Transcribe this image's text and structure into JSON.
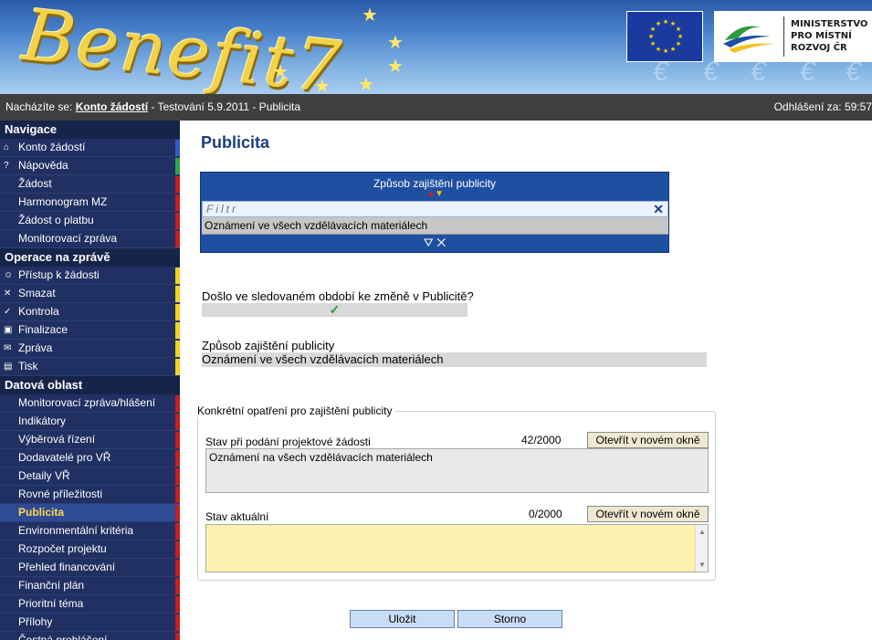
{
  "header": {
    "brand": "Benefit7",
    "ministry_lines": [
      "MINISTERSTVO",
      "PRO MÍSTNÍ",
      "ROZVOJ ČR"
    ]
  },
  "location_bar": {
    "prefix": "Nacházíte se:",
    "link": "Konto žádostí",
    "rest": "- Testování 5.9.2011 - Publicita",
    "logout": "Odhlášení za: 59:57"
  },
  "sidebar": {
    "sections": [
      {
        "title": "Navigace",
        "items": [
          {
            "label": "Konto žádostí",
            "icon": "home-icon",
            "glyph": "⌂",
            "marker": "blue"
          },
          {
            "label": "Nápověda",
            "icon": "help-icon",
            "glyph": "?",
            "marker": "green"
          },
          {
            "label": "Žádost",
            "icon": "",
            "glyph": "",
            "marker": "red"
          },
          {
            "label": "Harmonogram MZ",
            "icon": "",
            "glyph": "",
            "marker": "red"
          },
          {
            "label": "Žádost o platbu",
            "icon": "",
            "glyph": "",
            "marker": "red"
          },
          {
            "label": "Monitorovací zpráva",
            "icon": "",
            "glyph": "",
            "marker": "red"
          }
        ]
      },
      {
        "title": "Operace na zprávě",
        "items": [
          {
            "label": "Přístup k žádosti",
            "icon": "user-icon",
            "glyph": "☺",
            "marker": "yellow"
          },
          {
            "label": "Smazat",
            "icon": "delete-icon",
            "glyph": "✕",
            "marker": "yellow"
          },
          {
            "label": "Kontrola",
            "icon": "check-icon",
            "glyph": "✓",
            "marker": "yellow"
          },
          {
            "label": "Finalizace",
            "icon": "lock-icon",
            "glyph": "▣",
            "marker": "yellow"
          },
          {
            "label": "Zpráva",
            "icon": "mail-icon",
            "glyph": "✉",
            "marker": "yellow"
          },
          {
            "label": "Tisk",
            "icon": "print-icon",
            "glyph": "▤",
            "marker": "yellow"
          }
        ]
      },
      {
        "title": "Datová oblast",
        "items": [
          {
            "label": "Monitorovací zpráva/hlášení",
            "icon": "",
            "glyph": "",
            "marker": "red"
          },
          {
            "label": "Indikátory",
            "icon": "",
            "glyph": "",
            "marker": "red"
          },
          {
            "label": "Výběrová řízení",
            "icon": "",
            "glyph": "",
            "marker": "red"
          },
          {
            "label": "Dodavatelé pro VŘ",
            "icon": "",
            "glyph": "",
            "marker": "red"
          },
          {
            "label": "Detaily VŘ",
            "icon": "",
            "glyph": "",
            "marker": "red"
          },
          {
            "label": "Rovné příležitosti",
            "icon": "",
            "glyph": "",
            "marker": "red"
          },
          {
            "label": "Publicita",
            "icon": "",
            "glyph": "",
            "marker": "red",
            "active": true
          },
          {
            "label": "Environmentální kritéria",
            "icon": "",
            "glyph": "",
            "marker": "red"
          },
          {
            "label": "Rozpočet projektu",
            "icon": "",
            "glyph": "",
            "marker": "red"
          },
          {
            "label": "Přehled financování",
            "icon": "",
            "glyph": "",
            "marker": "red"
          },
          {
            "label": "Finanční plán",
            "icon": "",
            "glyph": "",
            "marker": "red"
          },
          {
            "label": "Prioritní téma",
            "icon": "",
            "glyph": "",
            "marker": "red"
          },
          {
            "label": "Přílohy",
            "icon": "",
            "glyph": "",
            "marker": "red"
          },
          {
            "label": "Čestná prohlášení",
            "icon": "",
            "glyph": "",
            "marker": "red"
          }
        ]
      }
    ]
  },
  "main": {
    "title": "Publicita",
    "grid": {
      "column_header": "Způsob zajištění publicity",
      "filter_placeholder": "Filtr",
      "rows": [
        "Oznámení ve všech vzdělávacích materiálech"
      ]
    },
    "question1": {
      "label": "Došlo ve sledovaném období ke změně v Publicitě?",
      "value": "✓"
    },
    "question2": {
      "label": "Způsob zajištění publicity",
      "value": "Oznámení ve všech vzdělávacích materiálech"
    },
    "fieldset": {
      "legend": "Konkrétní opatření pro zajištění publicity",
      "field1": {
        "label": "Stav při podání projektové žádosti",
        "counter": "42/2000",
        "button": "Otevřít v novém okně",
        "value": "Oznámení na všech vzdělávacích materiálech"
      },
      "field2": {
        "label": "Stav aktuální",
        "counter": "0/2000",
        "button": "Otevřít v novém okně",
        "value": ""
      }
    },
    "actions": {
      "save": "Uložit",
      "cancel": "Storno"
    }
  },
  "colors": {
    "sidebar_bg": "#1f2f5e",
    "active_item": "#ffd84a",
    "title_blue": "#1f3d7a",
    "grid_blue": "#1f4fa0",
    "textarea_yellow": "#fbf2b0"
  }
}
